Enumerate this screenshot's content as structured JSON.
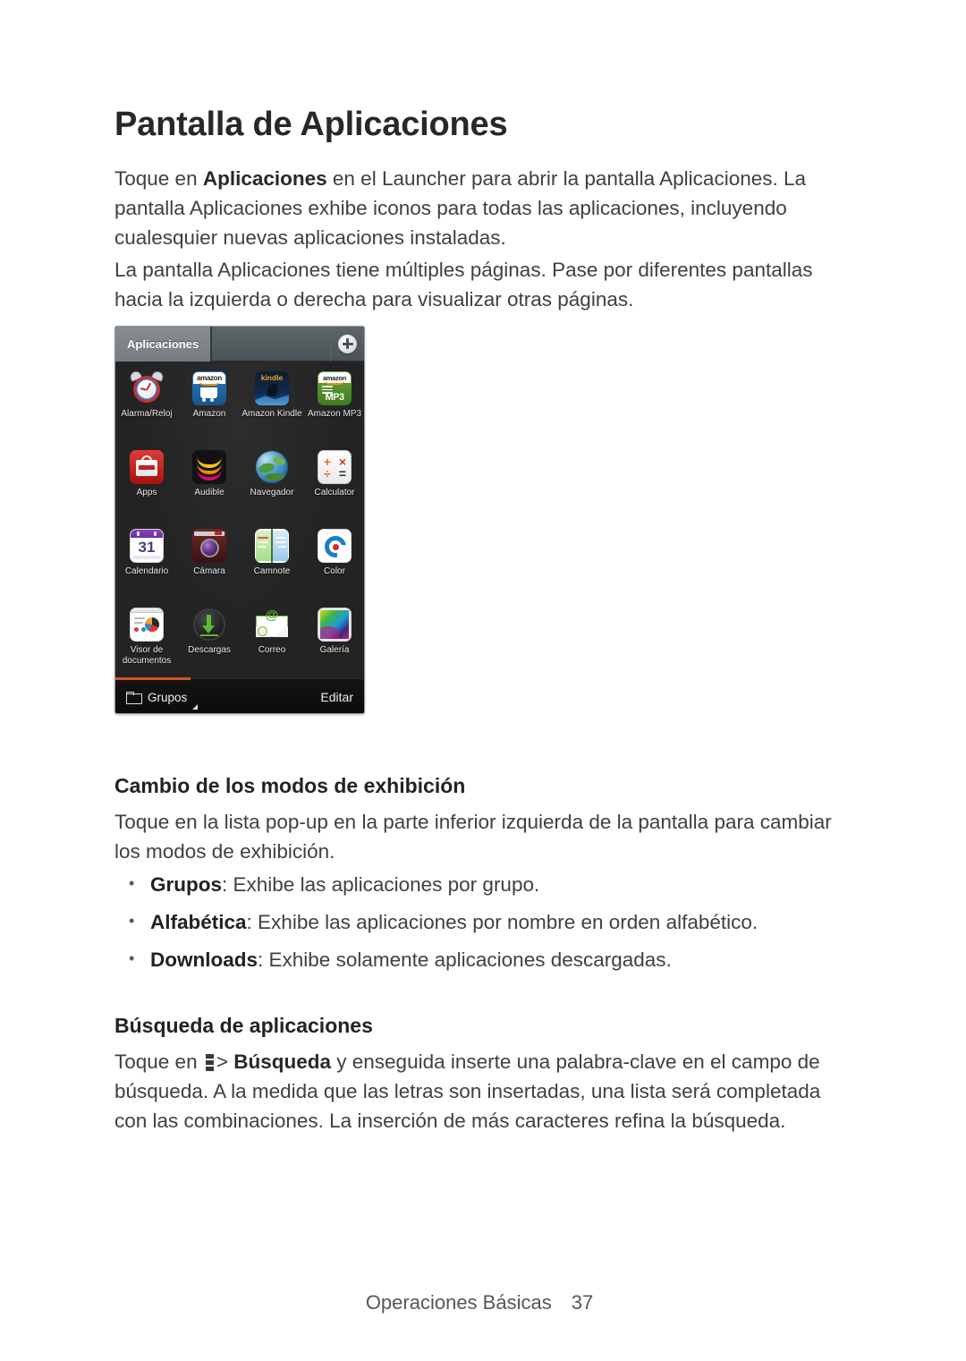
{
  "document": {
    "title": "Pantalla de Aplicaciones",
    "paragraphs": {
      "p1_prefix": "Toque en ",
      "p1_bold": "Aplicaciones",
      "p1_rest": " en el Launcher para abrir la pantalla Aplicaciones. La pantalla Aplicaciones exhibe iconos para todas las aplicaciones, incluyendo cualesquier nuevas aplicaciones instaladas.",
      "p2": "La pantalla Aplicaciones tiene múltiples páginas. Pase por diferentes pantallas hacia la izquierda o derecha para visualizar otras páginas.",
      "p3": "Toque en la lista pop-up en la parte inferior izquierda de la pantalla para cambiar los modos de exhibición.",
      "p4_prefix": "Toque en ",
      "p4_bold": "Búsqueda",
      "p4_rest": " y enseguida inserte una palabra-clave en el campo de búsqueda. A la medida que las letras son insertadas, una lista será completada con las combinaciones. La inserción de más caracteres refina la búsqueda."
    },
    "subheadings": {
      "display_modes": "Cambio de los modos de exhibición",
      "app_search": "Búsqueda de aplicaciones"
    },
    "bullets": [
      {
        "term": "Grupos",
        "desc": ": Exhibe las aplicaciones por grupo."
      },
      {
        "term": "Alfabética",
        "desc": ": Exhibe las aplicaciones por nombre en orden alfabético."
      },
      {
        "term": "Downloads",
        "desc": ": Exhibe solamente aplicaciones descargadas."
      }
    ],
    "footer": {
      "section": "Operaciones Básicas",
      "page_number": "37"
    }
  },
  "phone_screenshot": {
    "topbar": {
      "active_tab": "Aplicaciones",
      "add_icon": "plus-circle-icon"
    },
    "apps": [
      {
        "label": "Alarma/Reloj",
        "icon": "alarm-clock-icon"
      },
      {
        "label": "Amazon",
        "icon": "amazon-shopping-icon",
        "brand_text": "amazon"
      },
      {
        "label": "Amazon Kindle",
        "icon": "amazon-kindle-icon",
        "brand_text": "kindle"
      },
      {
        "label": "Amazon MP3",
        "icon": "amazon-mp3-icon",
        "brand_text": "amazon",
        "sub_text": "MP3"
      },
      {
        "label": "Apps",
        "icon": "verizon-apps-icon"
      },
      {
        "label": "Audible",
        "icon": "audible-icon"
      },
      {
        "label": "Navegador",
        "icon": "browser-globe-icon"
      },
      {
        "label": "Calculator",
        "icon": "calculator-icon",
        "ops": [
          "+",
          "×",
          "÷",
          "="
        ]
      },
      {
        "label": "Calendario",
        "icon": "calendar-icon",
        "day": "31"
      },
      {
        "label": "Cámara",
        "icon": "camera-icon"
      },
      {
        "label": "Camnote",
        "icon": "camnote-icon"
      },
      {
        "label": "Color",
        "icon": "color-icon"
      },
      {
        "label": "Visor de documentos",
        "icon": "document-viewer-icon"
      },
      {
        "label": "Descargas",
        "icon": "downloads-icon"
      },
      {
        "label": "Correo",
        "icon": "email-icon"
      },
      {
        "label": "Galería",
        "icon": "gallery-icon"
      }
    ],
    "bottombar": {
      "folder_icon": "folder-icon",
      "mode_label": "Grupos",
      "dropdown_icon": "dropdown-triangle-icon",
      "edit_label": "Editar"
    }
  },
  "colors": {
    "page_background": "#ffffff",
    "body_text": "#404043",
    "heading_text": "#28282a",
    "shot_topbar": "#535b5f",
    "shot_tab_active": "#7a8084",
    "shot_grid_bg": "#232323",
    "shot_bottombar": "#0f0f0f",
    "page_indicator": "#d4541f",
    "footer_text": "#55555a"
  }
}
